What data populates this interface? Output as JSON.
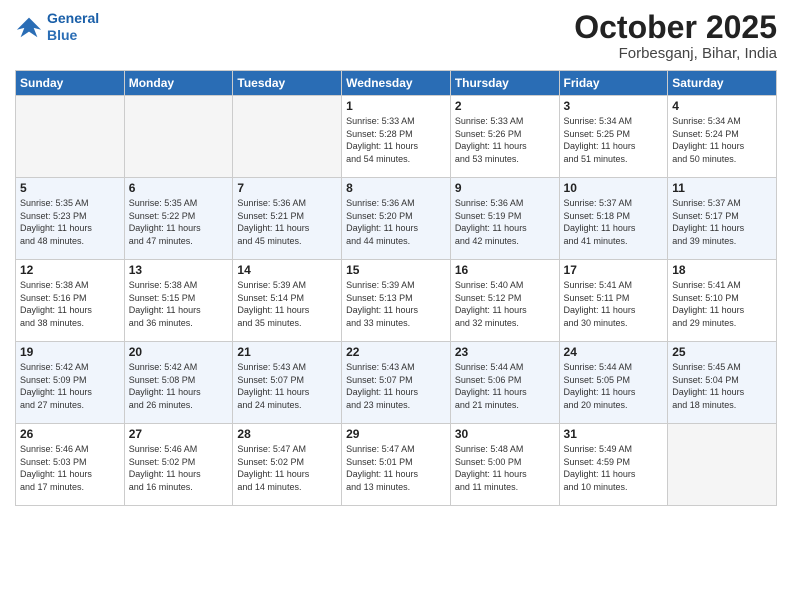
{
  "header": {
    "logo_line1": "General",
    "logo_line2": "Blue",
    "month_title": "October 2025",
    "location": "Forbesganj, Bihar, India"
  },
  "weekdays": [
    "Sunday",
    "Monday",
    "Tuesday",
    "Wednesday",
    "Thursday",
    "Friday",
    "Saturday"
  ],
  "weeks": [
    [
      {
        "day": "",
        "info": ""
      },
      {
        "day": "",
        "info": ""
      },
      {
        "day": "",
        "info": ""
      },
      {
        "day": "1",
        "info": "Sunrise: 5:33 AM\nSunset: 5:28 PM\nDaylight: 11 hours\nand 54 minutes."
      },
      {
        "day": "2",
        "info": "Sunrise: 5:33 AM\nSunset: 5:26 PM\nDaylight: 11 hours\nand 53 minutes."
      },
      {
        "day": "3",
        "info": "Sunrise: 5:34 AM\nSunset: 5:25 PM\nDaylight: 11 hours\nand 51 minutes."
      },
      {
        "day": "4",
        "info": "Sunrise: 5:34 AM\nSunset: 5:24 PM\nDaylight: 11 hours\nand 50 minutes."
      }
    ],
    [
      {
        "day": "5",
        "info": "Sunrise: 5:35 AM\nSunset: 5:23 PM\nDaylight: 11 hours\nand 48 minutes."
      },
      {
        "day": "6",
        "info": "Sunrise: 5:35 AM\nSunset: 5:22 PM\nDaylight: 11 hours\nand 47 minutes."
      },
      {
        "day": "7",
        "info": "Sunrise: 5:36 AM\nSunset: 5:21 PM\nDaylight: 11 hours\nand 45 minutes."
      },
      {
        "day": "8",
        "info": "Sunrise: 5:36 AM\nSunset: 5:20 PM\nDaylight: 11 hours\nand 44 minutes."
      },
      {
        "day": "9",
        "info": "Sunrise: 5:36 AM\nSunset: 5:19 PM\nDaylight: 11 hours\nand 42 minutes."
      },
      {
        "day": "10",
        "info": "Sunrise: 5:37 AM\nSunset: 5:18 PM\nDaylight: 11 hours\nand 41 minutes."
      },
      {
        "day": "11",
        "info": "Sunrise: 5:37 AM\nSunset: 5:17 PM\nDaylight: 11 hours\nand 39 minutes."
      }
    ],
    [
      {
        "day": "12",
        "info": "Sunrise: 5:38 AM\nSunset: 5:16 PM\nDaylight: 11 hours\nand 38 minutes."
      },
      {
        "day": "13",
        "info": "Sunrise: 5:38 AM\nSunset: 5:15 PM\nDaylight: 11 hours\nand 36 minutes."
      },
      {
        "day": "14",
        "info": "Sunrise: 5:39 AM\nSunset: 5:14 PM\nDaylight: 11 hours\nand 35 minutes."
      },
      {
        "day": "15",
        "info": "Sunrise: 5:39 AM\nSunset: 5:13 PM\nDaylight: 11 hours\nand 33 minutes."
      },
      {
        "day": "16",
        "info": "Sunrise: 5:40 AM\nSunset: 5:12 PM\nDaylight: 11 hours\nand 32 minutes."
      },
      {
        "day": "17",
        "info": "Sunrise: 5:41 AM\nSunset: 5:11 PM\nDaylight: 11 hours\nand 30 minutes."
      },
      {
        "day": "18",
        "info": "Sunrise: 5:41 AM\nSunset: 5:10 PM\nDaylight: 11 hours\nand 29 minutes."
      }
    ],
    [
      {
        "day": "19",
        "info": "Sunrise: 5:42 AM\nSunset: 5:09 PM\nDaylight: 11 hours\nand 27 minutes."
      },
      {
        "day": "20",
        "info": "Sunrise: 5:42 AM\nSunset: 5:08 PM\nDaylight: 11 hours\nand 26 minutes."
      },
      {
        "day": "21",
        "info": "Sunrise: 5:43 AM\nSunset: 5:07 PM\nDaylight: 11 hours\nand 24 minutes."
      },
      {
        "day": "22",
        "info": "Sunrise: 5:43 AM\nSunset: 5:07 PM\nDaylight: 11 hours\nand 23 minutes."
      },
      {
        "day": "23",
        "info": "Sunrise: 5:44 AM\nSunset: 5:06 PM\nDaylight: 11 hours\nand 21 minutes."
      },
      {
        "day": "24",
        "info": "Sunrise: 5:44 AM\nSunset: 5:05 PM\nDaylight: 11 hours\nand 20 minutes."
      },
      {
        "day": "25",
        "info": "Sunrise: 5:45 AM\nSunset: 5:04 PM\nDaylight: 11 hours\nand 18 minutes."
      }
    ],
    [
      {
        "day": "26",
        "info": "Sunrise: 5:46 AM\nSunset: 5:03 PM\nDaylight: 11 hours\nand 17 minutes."
      },
      {
        "day": "27",
        "info": "Sunrise: 5:46 AM\nSunset: 5:02 PM\nDaylight: 11 hours\nand 16 minutes."
      },
      {
        "day": "28",
        "info": "Sunrise: 5:47 AM\nSunset: 5:02 PM\nDaylight: 11 hours\nand 14 minutes."
      },
      {
        "day": "29",
        "info": "Sunrise: 5:47 AM\nSunset: 5:01 PM\nDaylight: 11 hours\nand 13 minutes."
      },
      {
        "day": "30",
        "info": "Sunrise: 5:48 AM\nSunset: 5:00 PM\nDaylight: 11 hours\nand 11 minutes."
      },
      {
        "day": "31",
        "info": "Sunrise: 5:49 AM\nSunset: 4:59 PM\nDaylight: 11 hours\nand 10 minutes."
      },
      {
        "day": "",
        "info": ""
      }
    ]
  ]
}
